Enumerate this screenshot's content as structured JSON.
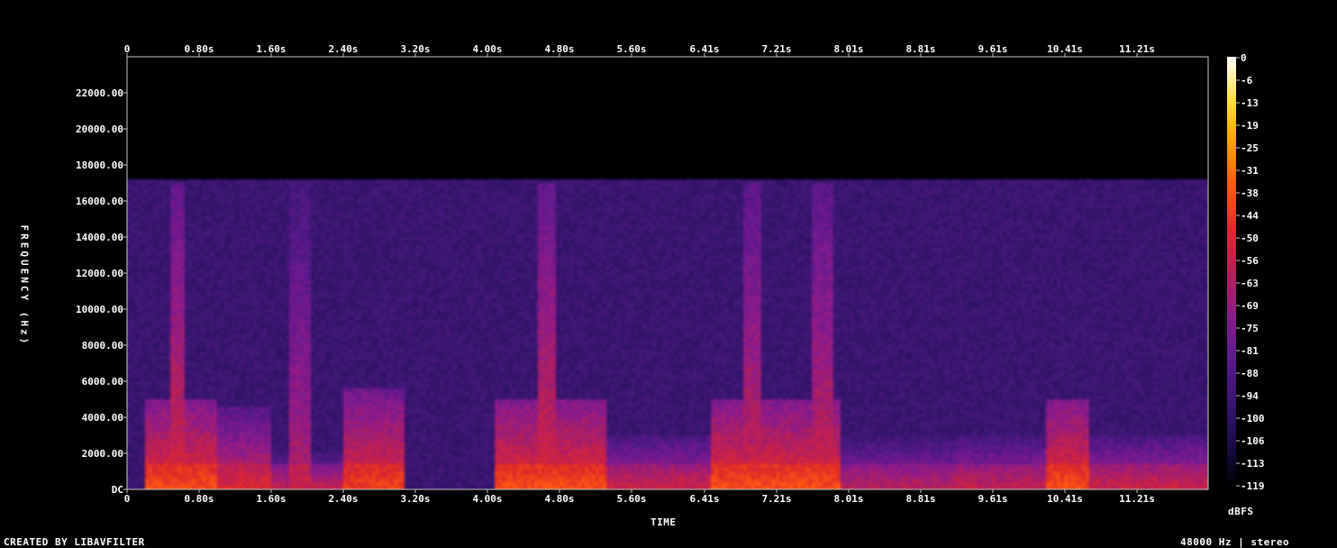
{
  "footer": {
    "created_by": "CREATED BY LIBAVFILTER",
    "sample_info": "48000 Hz | stereo"
  },
  "chart_data": {
    "type": "heatmap",
    "title": "",
    "xlabel": "TIME",
    "ylabel": "FREQUENCY (Hz)",
    "colorbar_label": "dBFS",
    "x_ticks": [
      "0",
      "0.80s",
      "1.60s",
      "2.40s",
      "3.20s",
      "4.00s",
      "4.80s",
      "5.60s",
      "6.41s",
      "7.21s",
      "8.01s",
      "8.81s",
      "9.61s",
      "10.41s",
      "11.21s"
    ],
    "x_tick_values": [
      0,
      0.8,
      1.6,
      2.4,
      3.2,
      4.0,
      4.8,
      5.6,
      6.41,
      7.21,
      8.01,
      8.81,
      9.61,
      10.41,
      11.21
    ],
    "xlim": [
      0,
      12.0
    ],
    "y_ticks": [
      "DC",
      "2000.00",
      "4000.00",
      "6000.00",
      "8000.00",
      "10000.00",
      "12000.00",
      "14000.00",
      "16000.00",
      "18000.00",
      "20000.00",
      "22000.00"
    ],
    "y_tick_values": [
      0,
      2000,
      4000,
      6000,
      8000,
      10000,
      12000,
      14000,
      16000,
      18000,
      20000,
      22000
    ],
    "ylim": [
      0,
      24000
    ],
    "colorbar_ticks": [
      "0",
      "-6",
      "-13",
      "-19",
      "-25",
      "-31",
      "-38",
      "-44",
      "-50",
      "-56",
      "-63",
      "-69",
      "-75",
      "-81",
      "-88",
      "-94",
      "-100",
      "-106",
      "-113",
      "-119"
    ],
    "colorbar_range": [
      -119,
      0
    ],
    "colormap": [
      "#000000",
      "#1a0a4a",
      "#3a1670",
      "#5e1a8e",
      "#8a1a8a",
      "#b81f5a",
      "#e02a2a",
      "#ff5a10",
      "#ffa000",
      "#ffe040",
      "#ffffff"
    ],
    "noise_floor_dbfs": -95,
    "cutoff_hz": 17200,
    "events": [
      {
        "start": 0.2,
        "end": 1.0,
        "peak_dbfs": -45,
        "max_freq": 5000
      },
      {
        "start": 0.5,
        "end": 0.65,
        "peak_dbfs": -52,
        "max_freq": 17000
      },
      {
        "start": 1.0,
        "end": 1.6,
        "peak_dbfs": -55,
        "max_freq": 4500
      },
      {
        "start": 1.25,
        "end": 2.4,
        "peak_dbfs": -62,
        "max_freq": 2000
      },
      {
        "start": 1.8,
        "end": 2.05,
        "peak_dbfs": -62,
        "max_freq": 17000
      },
      {
        "start": 2.4,
        "end": 3.1,
        "peak_dbfs": -48,
        "max_freq": 5500
      },
      {
        "start": 4.1,
        "end": 5.3,
        "peak_dbfs": -45,
        "max_freq": 5000
      },
      {
        "start": 4.55,
        "end": 4.75,
        "peak_dbfs": -52,
        "max_freq": 17000
      },
      {
        "start": 5.3,
        "end": 6.8,
        "peak_dbfs": -60,
        "max_freq": 3000
      },
      {
        "start": 6.5,
        "end": 7.9,
        "peak_dbfs": -45,
        "max_freq": 5000
      },
      {
        "start": 6.85,
        "end": 7.05,
        "peak_dbfs": -55,
        "max_freq": 17000
      },
      {
        "start": 7.6,
        "end": 7.85,
        "peak_dbfs": -55,
        "max_freq": 17000
      },
      {
        "start": 7.9,
        "end": 9.4,
        "peak_dbfs": -65,
        "max_freq": 3000
      },
      {
        "start": 9.2,
        "end": 10.2,
        "peak_dbfs": -62,
        "max_freq": 3000
      },
      {
        "start": 10.2,
        "end": 10.7,
        "peak_dbfs": -45,
        "max_freq": 5000
      },
      {
        "start": 10.7,
        "end": 12.0,
        "peak_dbfs": -60,
        "max_freq": 3000
      }
    ]
  }
}
